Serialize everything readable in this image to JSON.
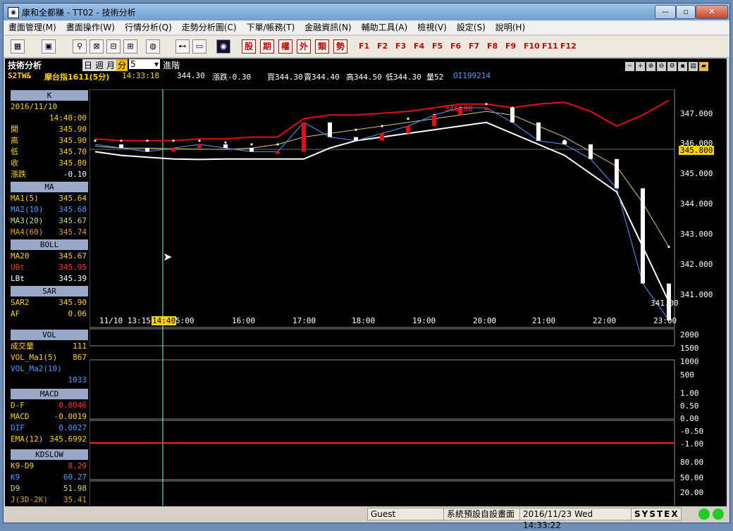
{
  "window": {
    "title": "康和全都賺 - TT02 - 技術分析"
  },
  "menu": [
    "畫面管理(M)",
    "畫面操作(W)",
    "行情分析(Q)",
    "走勢分析圖(C)",
    "下單/帳務(T)",
    "金融資訊(N)",
    "輔助工具(A)",
    "檢視(V)",
    "設定(S)",
    "說明(H)"
  ],
  "toolbar": {
    "red_buttons": [
      "股",
      "期",
      "權",
      "外",
      "類",
      "勢"
    ],
    "fkeys": [
      "F1",
      "F2",
      "F3",
      "F4",
      "F5",
      "F6",
      "F7",
      "F8",
      "F9",
      "F10",
      "F11",
      "F12"
    ]
  },
  "chart_header": {
    "title": "技術分析",
    "periods": [
      "日",
      "週",
      "月",
      "分"
    ],
    "interval": "5",
    "advanced": "進階",
    "symbol": "S2TW&",
    "name": "摩台指1611(5分)",
    "time": "14:33:18",
    "price": "344.30",
    "change": "漲跌-0.30",
    "bid": "買344.30",
    "ask": "賣344.40",
    "high": "高344.50",
    "low": "低344.30",
    "vol": "量52",
    "oi": "OI199214"
  },
  "left_panel": {
    "k": {
      "title": "K",
      "date": "2016/11/10",
      "time": "14:40:00",
      "rows": [
        {
          "k": "開",
          "v": "345.90"
        },
        {
          "k": "高",
          "v": "345.90"
        },
        {
          "k": "低",
          "v": "345.70"
        },
        {
          "k": "收",
          "v": "345.80"
        },
        {
          "k": "漲跌",
          "v": "-0.10"
        }
      ]
    },
    "ma": {
      "title": "MA",
      "rows": [
        {
          "k": "MA1(5)",
          "v": "345.64"
        },
        {
          "k": "MA2(10)",
          "v": "345.68"
        },
        {
          "k": "MA3(20)",
          "v": "345.67"
        },
        {
          "k": "MA4(60)",
          "v": "345.74"
        }
      ]
    },
    "boll": {
      "title": "BOLL",
      "rows": [
        {
          "k": "MA20",
          "v": "345.67"
        },
        {
          "k": "UBt",
          "v": "345.95"
        },
        {
          "k": "LBt",
          "v": "345.39"
        }
      ]
    },
    "sar": {
      "title": "SAR",
      "rows": [
        {
          "k": "SAR2",
          "v": "345.90"
        },
        {
          "k": "AF",
          "v": "0.06"
        }
      ]
    },
    "vol": {
      "title": "VOL",
      "rows": [
        {
          "k": "成交量",
          "v": "111"
        },
        {
          "k": "VOL_Ma1(5)",
          "v": "867"
        },
        {
          "k": "VOL_Ma2(10)",
          "v": ""
        },
        {
          "k": "",
          "v": "1033"
        }
      ]
    },
    "macd": {
      "title": "MACD",
      "rows": [
        {
          "k": "D-F",
          "v": "0.0046"
        },
        {
          "k": "MACD",
          "v": "-0.0019"
        },
        {
          "k": "DIF",
          "v": "0.0027"
        },
        {
          "k": "EMA(12)",
          "v": "345.6992"
        }
      ]
    },
    "kd": {
      "title": "KDSLOW",
      "rows": [
        {
          "k": "K9-D9",
          "v": "8.29"
        },
        {
          "k": "K9",
          "v": "60.27"
        },
        {
          "k": "D9",
          "v": "51.98"
        },
        {
          "k": "J(3D-2K)",
          "v": "35.41"
        }
      ]
    }
  },
  "price_axis": [
    "347.000",
    "346.000",
    "345.800",
    "345.000",
    "344.000",
    "343.000",
    "342.000",
    "341.000"
  ],
  "price_marks": {
    "high_label": "346.90",
    "low_label": "341.00"
  },
  "time_axis": [
    "11/10 13:15",
    "14:40",
    "5:00",
    "16:00",
    "17:00",
    "18:00",
    "19:00",
    "20:00",
    "21:00",
    "22:00",
    "23:00"
  ],
  "vol_axis": [
    "2000",
    "1500",
    "1000",
    "500"
  ],
  "macd_axis": [
    "1.00",
    "0.50",
    "0.00",
    "-0.50",
    "-1.00"
  ],
  "kd_axis": [
    "80.00",
    "50.00",
    "20.00"
  ],
  "status": {
    "user": "Guest",
    "screen": "系統預設自設畫面",
    "datetime": "2016/11/23 Wed 14:33:22",
    "brand": "SYSTEX"
  },
  "chart_data": {
    "type": "line",
    "title": "摩台指1611(5分)",
    "ylim": [
      340.8,
      347.3
    ],
    "x": [
      "13:15",
      "13:35",
      "13:55",
      "14:15",
      "14:40",
      "15:00",
      "15:30",
      "16:00",
      "16:30",
      "17:00",
      "17:30",
      "18:00",
      "18:30",
      "19:00",
      "19:30",
      "20:00",
      "20:30",
      "21:00",
      "21:30",
      "22:00",
      "22:30",
      "23:00",
      "23:15"
    ],
    "series": [
      {
        "name": "UBt",
        "values": [
          345.95,
          345.9,
          345.9,
          345.9,
          345.95,
          345.95,
          346.0,
          346.0,
          346.5,
          346.6,
          346.6,
          346.65,
          346.7,
          346.8,
          346.9,
          346.9,
          346.8,
          346.9,
          346.95,
          346.7,
          346.3,
          346.6,
          347.0
        ]
      },
      {
        "name": "MA20",
        "values": [
          345.75,
          345.7,
          345.7,
          345.68,
          345.67,
          345.66,
          345.7,
          345.8,
          346.0,
          346.1,
          346.2,
          346.3,
          346.4,
          346.5,
          346.6,
          346.7,
          346.6,
          346.3,
          346.0,
          345.6,
          345.2,
          344.2,
          343.0
        ]
      },
      {
        "name": "LBt",
        "values": [
          345.6,
          345.5,
          345.45,
          345.4,
          345.39,
          345.4,
          345.4,
          345.4,
          345.4,
          345.7,
          345.9,
          346.0,
          346.1,
          346.2,
          346.3,
          346.4,
          346.1,
          345.8,
          345.5,
          345.0,
          344.5,
          343.0,
          341.5
        ]
      },
      {
        "name": "SAR2",
        "values": [
          345.9,
          345.9,
          345.9,
          345.9,
          345.9,
          345.85,
          345.8,
          345.8,
          345.9,
          346.1,
          346.2,
          346.3,
          346.5,
          346.6,
          346.8,
          346.9,
          346.8,
          346.1,
          345.9,
          345.6,
          345.1,
          344.0,
          343.0
        ]
      },
      {
        "name": "close",
        "values": [
          345.8,
          345.7,
          345.6,
          345.7,
          345.8,
          345.7,
          345.6,
          345.6,
          346.4,
          346.0,
          345.9,
          346.1,
          346.3,
          346.6,
          346.8,
          346.8,
          346.4,
          345.9,
          345.8,
          345.4,
          344.6,
          342.0,
          341.0
        ]
      }
    ]
  }
}
